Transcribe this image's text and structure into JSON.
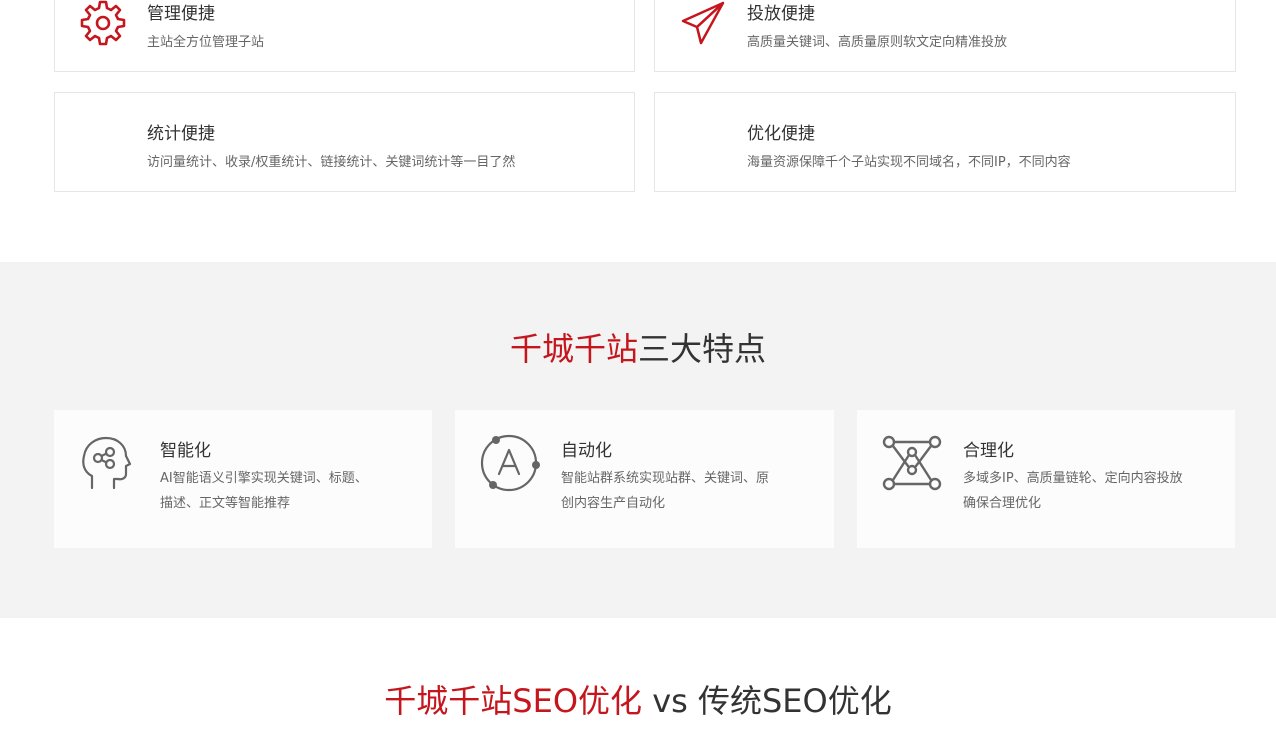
{
  "features": [
    {
      "title": "管理便捷",
      "desc": "主站全方位管理子站",
      "icon": "gear-icon"
    },
    {
      "title": "投放便捷",
      "desc": "高质量关键词、高质量原则软文定向精准投放",
      "icon": "paper-plane-icon"
    },
    {
      "title": "统计便捷",
      "desc": "访问量统计、收录/权重统计、链接统计、关键词统计等一目了然",
      "icon": ""
    },
    {
      "title": "优化便捷",
      "desc": "海量资源保障千个子站实现不同域名，不同IP，不同内容",
      "icon": ""
    }
  ],
  "traits_section": {
    "title_accent": "千城千站",
    "title_rest": "三大特点",
    "cards": [
      {
        "title": "智能化",
        "desc": "AI智能语义引擎实现关键词、标题、描述、正文等智能推荐",
        "icon": "brain-head-icon"
      },
      {
        "title": "自动化",
        "desc": "智能站群系统实现站群、关键词、原创内容生产自动化",
        "icon": "letter-a-orbit-icon"
      },
      {
        "title": "合理化",
        "desc": "多域多IP、高质量链轮、定向内容投放确保合理优化",
        "icon": "network-nodes-icon"
      }
    ]
  },
  "compare_section": {
    "title_accent": "千城千站SEO优化",
    "title_rest": " vs 传统SEO优化"
  },
  "colors": {
    "accent": "#c4161c",
    "gray_bg": "#f3f3f4",
    "icon_gray": "#666666"
  }
}
